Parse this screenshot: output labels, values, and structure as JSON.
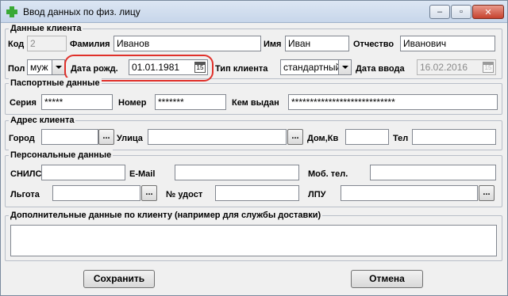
{
  "window": {
    "title": "Ввод данных по физ. лицу",
    "minimize": "–",
    "maximize": "▫",
    "close": "✕"
  },
  "client": {
    "group_title": "Данные клиента",
    "code_label": "Код",
    "code_value": "2",
    "surname_label": "Фамилия",
    "surname_value": "Иванов",
    "name_label": "Имя",
    "name_value": "Иван",
    "patronymic_label": "Отчество",
    "patronymic_value": "Иванович",
    "gender_label": "Пол",
    "gender_value": "муж",
    "birthdate_label": "Дата рожд.",
    "birthdate_value": "01.01.1981",
    "client_type_label": "Тип клиента",
    "client_type_value": "стандартный",
    "entry_date_label": "Дата ввода",
    "entry_date_value": "16.02.2016",
    "calendar_glyph": "15"
  },
  "passport": {
    "group_title": "Паспортные данные",
    "series_label": "Серия",
    "series_value": "*****",
    "number_label": "Номер",
    "number_value": "*******",
    "issued_label": "Кем выдан",
    "issued_value": "****************************"
  },
  "address": {
    "group_title": "Адрес клиента",
    "city_label": "Город",
    "city_value": "",
    "street_label": "Улица",
    "street_value": "",
    "house_label": "Дом,Кв",
    "house_value": "",
    "phone_label": "Тел",
    "phone_value": "",
    "browse": "..."
  },
  "personal": {
    "group_title": "Персональные данные",
    "snils_label": "СНИЛС",
    "snils_value": "",
    "email_label": "E-Mail",
    "email_value": "",
    "mobile_label": "Моб. тел.",
    "mobile_value": "",
    "benefit_label": "Льгота",
    "benefit_value": "",
    "cert_label": "№ удост",
    "cert_value": "",
    "lpu_label": "ЛПУ",
    "lpu_value": "",
    "browse": "..."
  },
  "extra": {
    "group_title": "Дополнительные данные по клиенту (например для службы доставки)"
  },
  "actions": {
    "save": "Сохранить",
    "cancel": "Отмена"
  }
}
